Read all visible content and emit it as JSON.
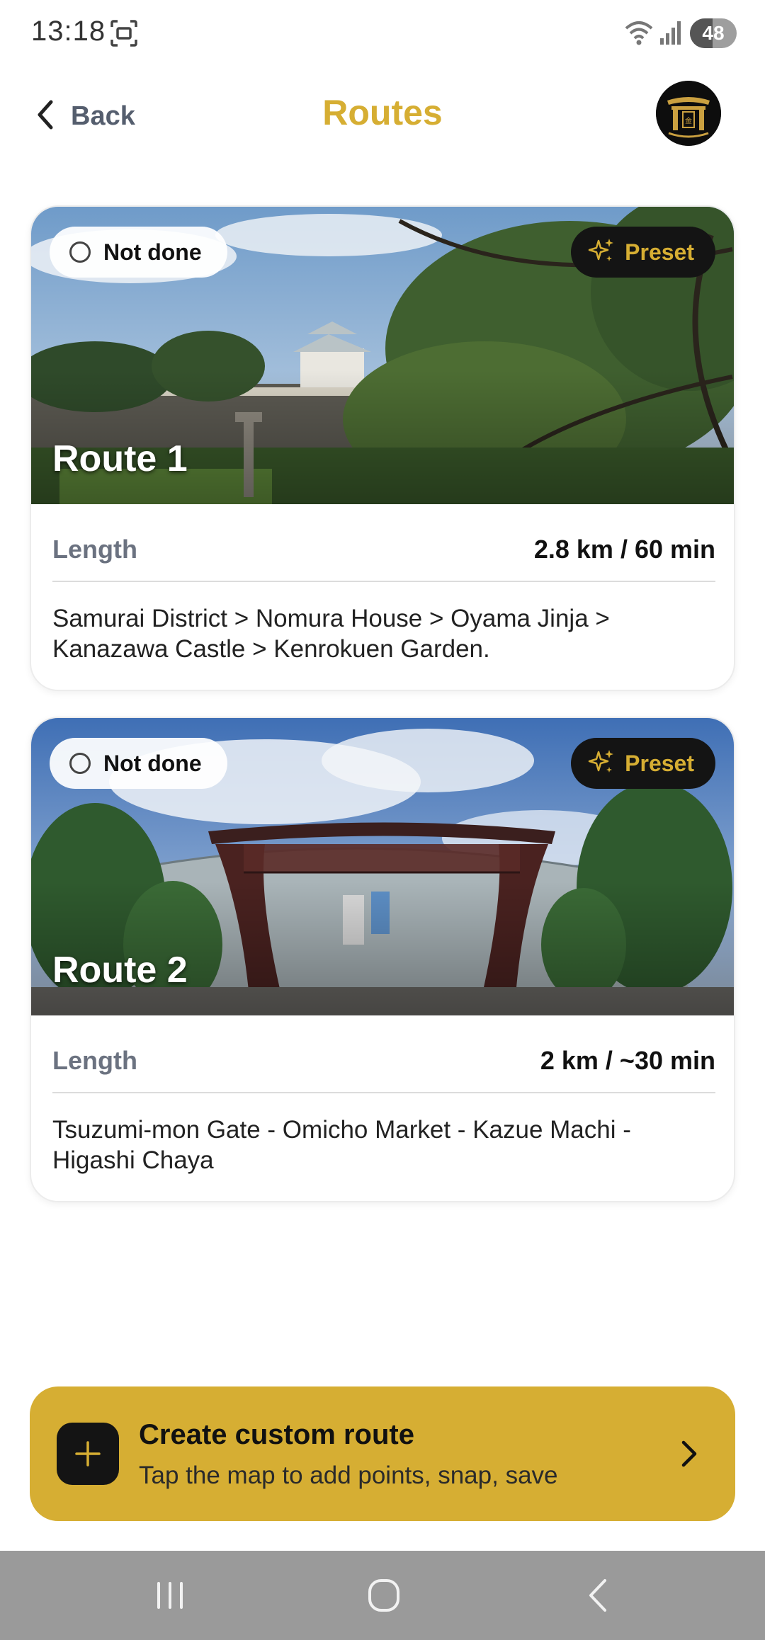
{
  "status_bar": {
    "time": "13:18",
    "battery": "48",
    "battery_level": 0.48,
    "icons": [
      "screenshot-icon",
      "wifi-icon",
      "signal-icon"
    ]
  },
  "header": {
    "back_label": "Back",
    "title": "Routes",
    "avatar": "Kanazawa Go logo"
  },
  "routes": [
    {
      "name": "Route 1",
      "status": "Not done",
      "badge": "Preset",
      "length_label": "Length",
      "length_value": "2.8 km / 60 min",
      "description": "Samurai District > Nomura House > Oyama Jinja > Kanazawa Castle > Kenrokuen Garden.",
      "photo": "Kanazawa Castle with trees"
    },
    {
      "name": "Route 2",
      "status": "Not done",
      "badge": "Preset",
      "length_label": "Length",
      "length_value": "2 km / ~30 min",
      "description": "Tsuzumi-mon Gate - Omicho Market - Kazue Machi - Higashi Chaya",
      "photo": "Tsuzumi-mon Gate at Kanazawa Station"
    }
  ],
  "create_route": {
    "title": "Create custom route",
    "subtitle": "Tap the map to add points, snap, save"
  },
  "nav_bar": {
    "buttons": [
      "recents-icon",
      "home-icon",
      "back-icon"
    ]
  },
  "colors": {
    "accent": "#d6ae33",
    "dark": "#141414",
    "muted": "#6b7280"
  }
}
